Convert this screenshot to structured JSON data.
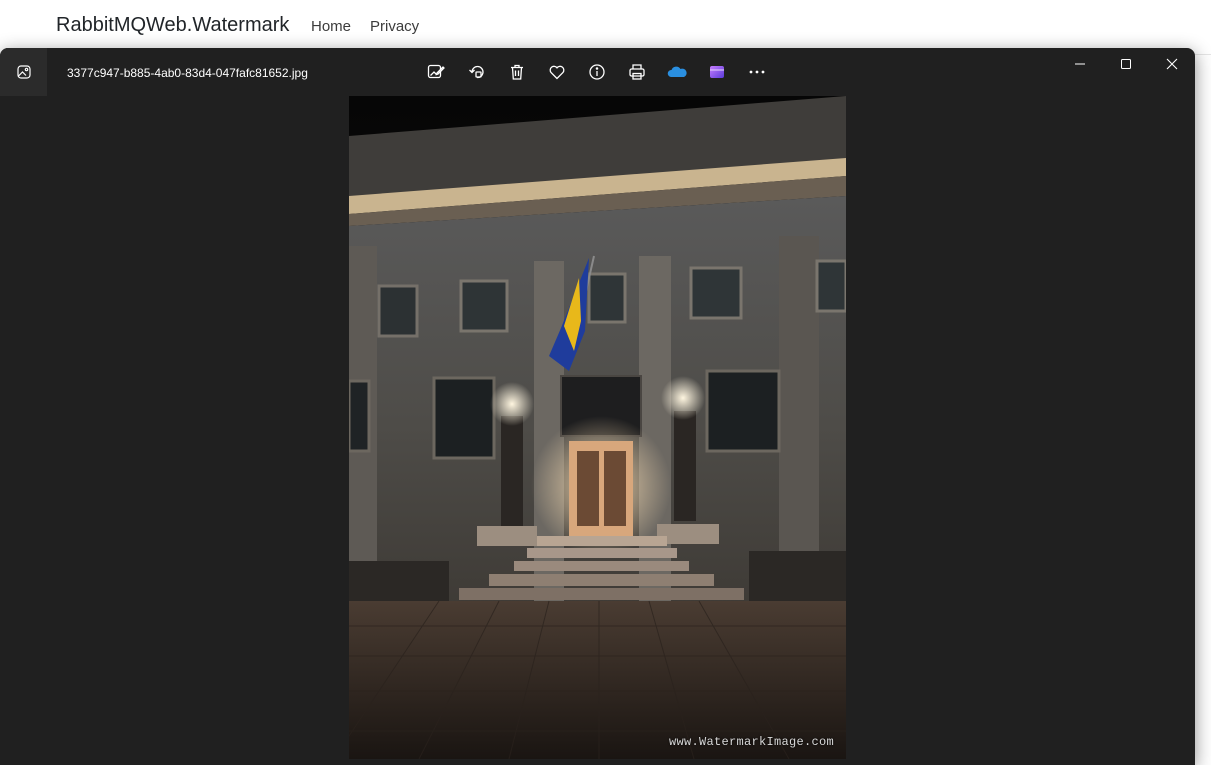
{
  "site": {
    "brand": "RabbitMQWeb.Watermark",
    "nav": [
      {
        "label": "Home"
      },
      {
        "label": "Privacy"
      }
    ]
  },
  "viewer": {
    "file_name": "3377c947-b885-4ab0-83d4-047fafc81652.jpg",
    "toolbar_icons": [
      "edit-image-icon",
      "rotate-icon",
      "delete-icon",
      "favorite-icon",
      "info-icon",
      "print-icon",
      "onedrive-icon",
      "clipchamp-icon",
      "more-icon"
    ],
    "window_controls": [
      "minimize-icon",
      "maximize-icon",
      "close-icon"
    ],
    "photo": {
      "subject": "building-entrance-night",
      "watermark": "www.WatermarkImage.com"
    }
  },
  "colors": {
    "window_bg": "#202020",
    "onedrive": "#2a8fe0",
    "clipchamp": "#8a5cf6",
    "icon": "#ffffff"
  }
}
